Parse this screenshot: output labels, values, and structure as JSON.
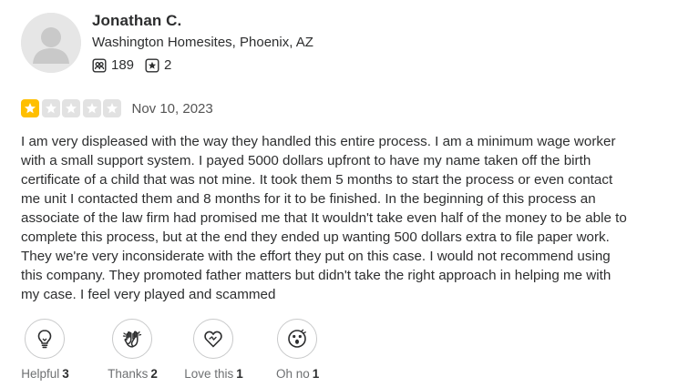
{
  "reviewer": {
    "name": "Jonathan C.",
    "location": "Washington Homesites, Phoenix, AZ",
    "friends_count": "189",
    "reviews_count": "2"
  },
  "rating": {
    "value": 1,
    "max": 5,
    "filled_color": "#ffbf00",
    "empty_color": "#e2e2e2",
    "date": "Nov 10, 2023"
  },
  "review": {
    "lines": [
      "I am very displeased with the way they handled this entire process. I am a minimum wage worker",
      "with a small support system. I payed 5000 dollars upfront to have my name taken off the birth",
      "certificate of a child that was not mine. It took them 5 months to start the process or even contact",
      "me unit I contacted them and 8 months for it to be finished. In the beginning of this process an",
      "associate of the law firm had promised me that It wouldn't take even half of the money to be able to",
      "complete this process, but at the end they ended up wanting 500 dollars extra to file paper work.",
      "They we're very inconsiderate with the effort they put on this case. I would not recommend using",
      "this company. They promoted father matters but didn't take the right approach in helping me with",
      "my case. I feel very played and scammed"
    ]
  },
  "reactions": [
    {
      "label": "Helpful",
      "count": "3",
      "icon": "lightbulb-icon"
    },
    {
      "label": "Thanks",
      "count": "2",
      "icon": "hands-icon"
    },
    {
      "label": "Love this",
      "count": "1",
      "icon": "heart-icon"
    },
    {
      "label": "Oh no",
      "count": "1",
      "icon": "surprised-face-icon"
    }
  ]
}
